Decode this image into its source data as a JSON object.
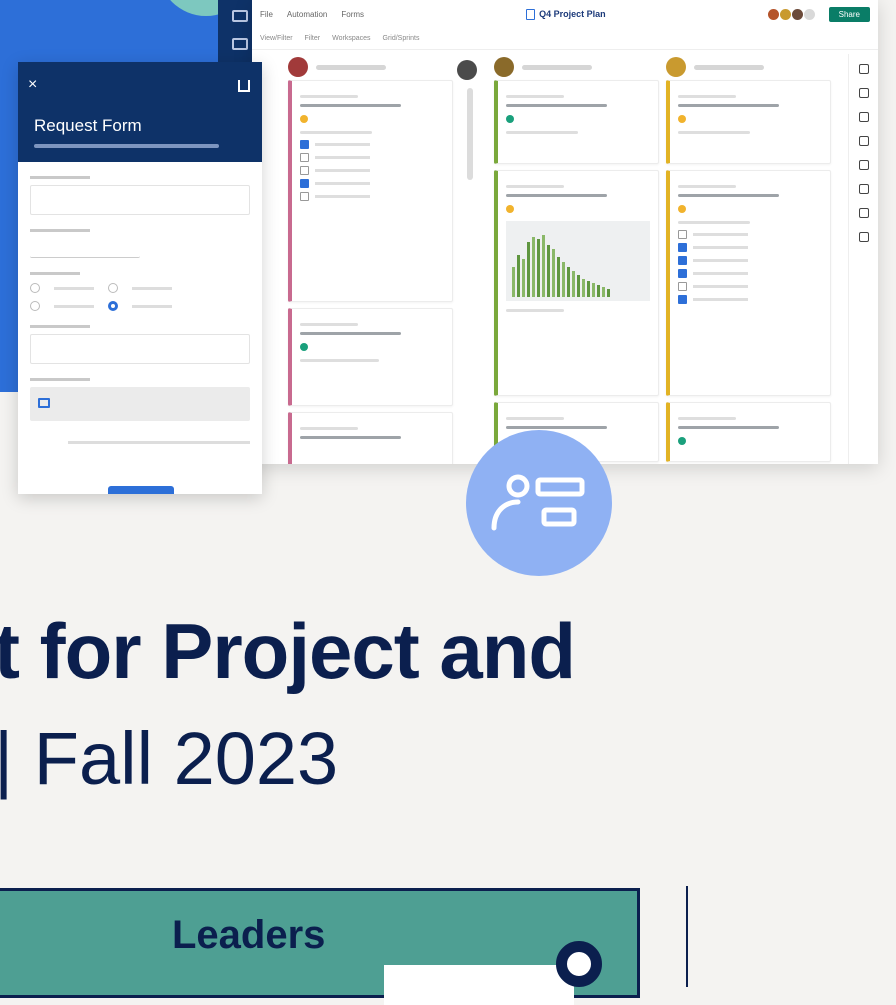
{
  "board": {
    "title": "Q4 Project Plan",
    "share_label": "Share",
    "menu": [
      "File",
      "Automation",
      "Forms"
    ],
    "toolbar": [
      "View/Filter",
      "Filter",
      "Workspaces",
      "Grid/Sprints"
    ]
  },
  "form": {
    "title": "Request Form",
    "close": "×"
  },
  "headline": {
    "line1": "t for Project and",
    "line2": "| Fall 2023"
  },
  "leaders": {
    "label": "Leaders"
  },
  "colors": {
    "brand_blue": "#2d6fd8",
    "navy": "#0e3268",
    "teal": "#4e9f93",
    "accent_green": "#0a7d67"
  },
  "chart_bars": [
    30,
    42,
    38,
    55,
    60,
    58,
    62,
    52,
    48,
    40,
    35,
    30,
    26,
    22,
    18,
    16,
    14,
    12,
    10,
    8
  ]
}
